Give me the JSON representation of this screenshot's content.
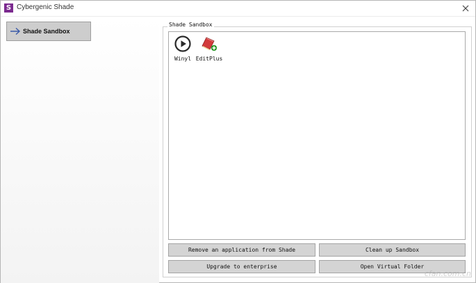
{
  "window": {
    "title": "Cybergenic Shade",
    "logo_letter": "S"
  },
  "nav": {
    "items": [
      {
        "label": "Shade Sandbox",
        "icon": "arrow-right-icon",
        "selected": true
      }
    ]
  },
  "sandbox": {
    "group_title": "Shade Sandbox",
    "apps": [
      {
        "name": "Winyl",
        "icon": "play-icon"
      },
      {
        "name": "EditPlus",
        "icon": "editplus-icon"
      }
    ]
  },
  "buttons": {
    "remove": "Remove an application from Shade",
    "cleanup": "Clean up Sandbox",
    "upgrade": "Upgrade to enterprise",
    "open_folder": "Open Virtual Folder"
  },
  "watermark": "cfan.com.cn",
  "colors": {
    "logo_bg": "#7b2a8f",
    "button_bg": "#d4d4d4",
    "nav_selected_bg": "#cdcdcd",
    "arrow": "#3a5aa8"
  }
}
